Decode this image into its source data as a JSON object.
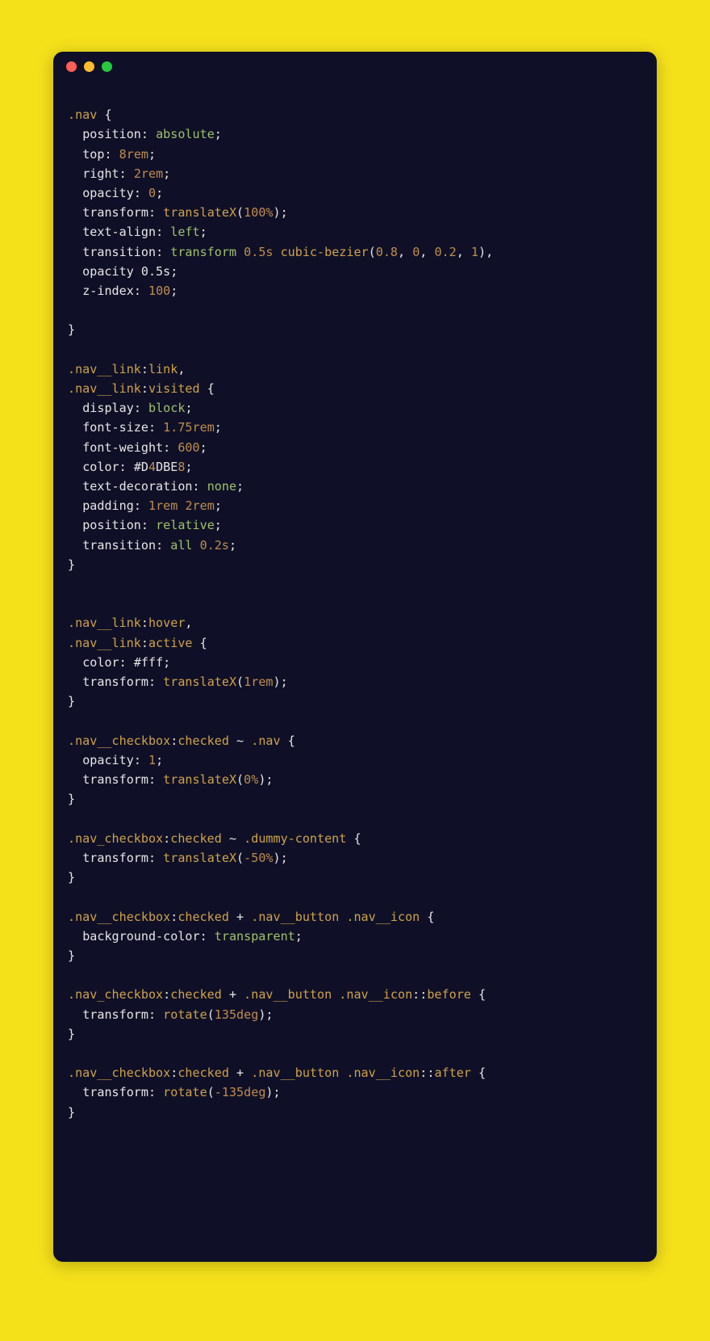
{
  "colors": {
    "page_bg": "#f5e11a",
    "window_bg": "#0f1027",
    "traffic_red": "#ff5f56",
    "traffic_yellow": "#ffbd2e",
    "traffic_green": "#27c93f",
    "text": "#e6e6e6",
    "selector": "#cfa24a",
    "keyword": "#9ec26b",
    "number": "#bf8c4e"
  },
  "code": {
    "lines": [
      "",
      ".nav {",
      "  position: absolute;",
      "  top: 8rem;",
      "  right: 2rem;",
      "  opacity: 0;",
      "  transform: translateX(100%);",
      "  text-align: left;",
      "  transition: transform 0.5s cubic-bezier(0.8, 0, 0.2, 1),",
      "  opacity 0.5s;",
      "  z-index: 100;",
      "",
      "}",
      "",
      ".nav__link:link,",
      ".nav__link:visited {",
      "  display: block;",
      "  font-size: 1.75rem;",
      "  font-weight: 600;",
      "  color: #D4DBE8;",
      "  text-decoration: none;",
      "  padding: 1rem 2rem;",
      "  position: relative;",
      "  transition: all 0.2s;",
      "}",
      "",
      "",
      ".nav__link:hover,",
      ".nav__link:active {",
      "  color: #fff;",
      "  transform: translateX(1rem);",
      "}",
      "",
      ".nav__checkbox:checked ~ .nav {",
      "  opacity: 1;",
      "  transform: translateX(0%);",
      "}",
      "",
      ".nav_checkbox:checked ~ .dummy-content {",
      "  transform: translateX(-50%);",
      "}",
      "",
      ".nav__checkbox:checked + .nav__button .nav__icon {",
      "  background-color: transparent;",
      "}",
      "",
      ".nav_checkbox:checked + .nav__button .nav__icon::before {",
      "  transform: rotate(135deg);",
      "}",
      "",
      ".nav__checkbox:checked + .nav__button .nav__icon::after {",
      "  transform: rotate(-135deg);",
      "}"
    ]
  }
}
